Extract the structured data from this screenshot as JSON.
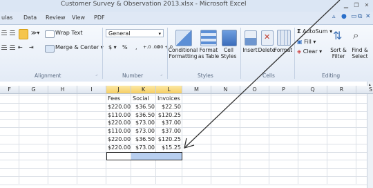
{
  "window": {
    "title": "Customer Survey & Observation 2013.xlsx - Microsoft Excel"
  },
  "tabs": [
    "ulas",
    "Data",
    "Review",
    "View",
    "PDF"
  ],
  "ribbon": {
    "alignment": {
      "label": "Alignment",
      "wrap_text": "Wrap Text",
      "merge_center": "Merge & Center"
    },
    "number": {
      "label": "Number",
      "format_value": "General",
      "currency": "$",
      "percent": "%",
      "comma": ",",
      "inc_decimal": "+.0 .00",
      "dec_decimal": ".00 +.0"
    },
    "styles": {
      "label": "Styles",
      "conditional": "Conditional\nFormatting",
      "format_table": "Format\nas Table",
      "cell_styles": "Cell\nStyles"
    },
    "cells": {
      "label": "Cells",
      "insert": "Insert",
      "delete": "Delete",
      "format": "Format"
    },
    "editing": {
      "label": "Editing",
      "autosum": "AutoSum",
      "fill": "Fill",
      "clear": "Clear",
      "sort_filter": "Sort &\nFilter",
      "find_select": "Find &\nSelect"
    }
  },
  "sheet": {
    "columns": [
      "F",
      "G",
      "H",
      "I",
      "J",
      "K",
      "L",
      "M",
      "N",
      "O",
      "P",
      "Q",
      "R",
      "S"
    ],
    "selected_columns": [
      "J",
      "K",
      "L"
    ],
    "headers": [
      "Fees",
      "Social",
      "Invoices"
    ],
    "rows": [
      [
        "$220.00",
        "$36.50",
        "$22.50"
      ],
      [
        "$110.00",
        "$36.50",
        "$120.25"
      ],
      [
        "$220.00",
        "$73.00",
        "$37.00"
      ],
      [
        "$110.00",
        "$73.00",
        "$37.00"
      ],
      [
        "$220.00",
        "$36.50",
        "$120.25"
      ],
      [
        "$220.00",
        "$73.00",
        "$15.25"
      ]
    ]
  },
  "colors": {
    "accent": "#f6cf64",
    "selection": "#b8cff0",
    "ribbon": "#e3ebf6"
  }
}
